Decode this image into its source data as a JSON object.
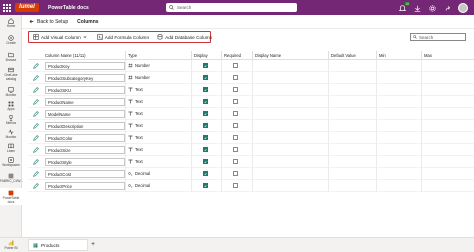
{
  "topbar": {
    "logo_text": "lumel",
    "app_title": "PowerTable docs",
    "search_placeholder": "Search",
    "notification_count": "10",
    "brand_color": "#742774"
  },
  "leftnav": {
    "items": [
      {
        "label": "Home",
        "icon": "home-icon"
      },
      {
        "label": "Create",
        "icon": "plus-icon"
      },
      {
        "label": "Browse",
        "icon": "folder-icon"
      },
      {
        "label": "OneLake catalog",
        "icon": "catalog-icon"
      },
      {
        "label": "Monitor",
        "icon": "monitor-icon"
      },
      {
        "label": "Apps",
        "icon": "apps-icon"
      },
      {
        "label": "Metrics",
        "icon": "trophy-icon"
      },
      {
        "label": "Monitor",
        "icon": "pulse-icon"
      },
      {
        "label": "Learn",
        "icon": "book-icon"
      },
      {
        "label": "Workspaces",
        "icon": "workspace-icon"
      },
      {
        "label": "FABRIC_CI/W...",
        "icon": "workspace-item-icon"
      },
      {
        "label": "PowerTable docs",
        "icon": "powertable-icon"
      }
    ],
    "power_label": "Power BI"
  },
  "command": {
    "back_label": "Back to Setup",
    "crumb": "Columns"
  },
  "toolbar": {
    "add_visual": "Add Visual Column",
    "add_formula": "Add Formula Column",
    "add_database": "Add Database Column",
    "search_placeholder": "Search"
  },
  "grid": {
    "headers": [
      "Column Name (11/11)",
      "Type",
      "Display",
      "Required",
      "Display Name",
      "Default Value",
      "Min",
      "Max"
    ],
    "rows": [
      {
        "name": "ProductKey",
        "type": "Number",
        "icon": "number-icon",
        "display": true,
        "required": false
      },
      {
        "name": "ProductSubcategoryKey",
        "type": "Number",
        "icon": "number-icon",
        "display": true,
        "required": false
      },
      {
        "name": "ProductSKU",
        "type": "Text",
        "icon": "text-icon",
        "display": true,
        "required": false
      },
      {
        "name": "ProductName",
        "type": "Text",
        "icon": "text-icon",
        "display": true,
        "required": false
      },
      {
        "name": "ModelName",
        "type": "Text",
        "icon": "text-icon",
        "display": true,
        "required": false
      },
      {
        "name": "ProductDescription",
        "type": "Text",
        "icon": "text-icon",
        "display": true,
        "required": false
      },
      {
        "name": "ProductColor",
        "type": "Text",
        "icon": "text-icon",
        "display": true,
        "required": false
      },
      {
        "name": "ProductSize",
        "type": "Text",
        "icon": "text-icon",
        "display": true,
        "required": false
      },
      {
        "name": "ProductStyle",
        "type": "Text",
        "icon": "text-icon",
        "display": true,
        "required": false
      },
      {
        "name": "ProductCost",
        "type": "Decimal",
        "icon": "decimal-icon",
        "display": true,
        "required": false
      },
      {
        "name": "ProductPrice",
        "type": "Decimal",
        "icon": "decimal-icon",
        "display": true,
        "required": false
      }
    ]
  },
  "bottom": {
    "tab_label": "Products"
  }
}
